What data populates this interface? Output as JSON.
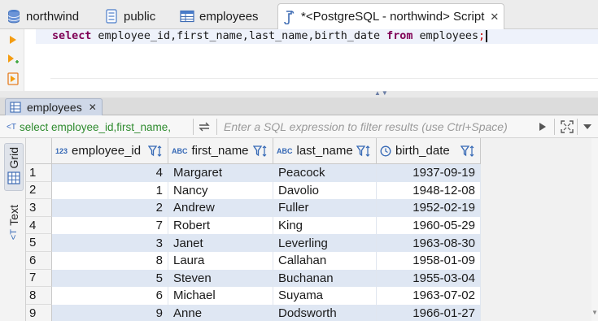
{
  "editor_tabs": [
    {
      "label": "northwind",
      "icon": "database-icon"
    },
    {
      "label": "public",
      "icon": "schema-icon"
    },
    {
      "label": "employees",
      "icon": "table-icon"
    },
    {
      "label": "*<PostgreSQL - northwind> Script",
      "icon": "sql-script-icon",
      "active": true
    }
  ],
  "editor": {
    "kw_select": "select",
    "columns": " employee_id,first_name,last_name,birth_date ",
    "kw_from": "from",
    "table": " employees",
    "terminator": ";"
  },
  "results_tab": {
    "label": "employees",
    "icon": "grid-table-icon"
  },
  "filter_bar": {
    "query_preview": "select employee_id,first_name,",
    "placeholder": "Enter a SQL expression to filter results (use Ctrl+Space)"
  },
  "side_tabs": {
    "grid": "Grid",
    "text": "Text"
  },
  "grid": {
    "columns": [
      {
        "label": "employee_id",
        "type_badge": "123"
      },
      {
        "label": "first_name",
        "type_badge": "ABC"
      },
      {
        "label": "last_name",
        "type_badge": "ABC"
      },
      {
        "label": "birth_date",
        "type_badge": "clock"
      }
    ],
    "rows": [
      {
        "n": "1",
        "employee_id": "4",
        "first_name": "Margaret",
        "last_name": "Peacock",
        "birth_date": "1937-09-19"
      },
      {
        "n": "2",
        "employee_id": "1",
        "first_name": "Nancy",
        "last_name": "Davolio",
        "birth_date": "1948-12-08"
      },
      {
        "n": "3",
        "employee_id": "2",
        "first_name": "Andrew",
        "last_name": "Fuller",
        "birth_date": "1952-02-19"
      },
      {
        "n": "4",
        "employee_id": "7",
        "first_name": "Robert",
        "last_name": "King",
        "birth_date": "1960-05-29"
      },
      {
        "n": "5",
        "employee_id": "3",
        "first_name": "Janet",
        "last_name": "Leverling",
        "birth_date": "1963-08-30"
      },
      {
        "n": "6",
        "employee_id": "8",
        "first_name": "Laura",
        "last_name": "Callahan",
        "birth_date": "1958-01-09"
      },
      {
        "n": "7",
        "employee_id": "5",
        "first_name": "Steven",
        "last_name": "Buchanan",
        "birth_date": "1955-03-04"
      },
      {
        "n": "8",
        "employee_id": "6",
        "first_name": "Michael",
        "last_name": "Suyama",
        "birth_date": "1963-07-02"
      },
      {
        "n": "9",
        "employee_id": "9",
        "first_name": "Anne",
        "last_name": "Dodsworth",
        "birth_date": "1966-01-27"
      }
    ]
  },
  "colors": {
    "keyword": "#7f0055",
    "accent": "#3568b5",
    "row_alt": "#dfe7f3",
    "filter_query": "#2e8b2e"
  }
}
